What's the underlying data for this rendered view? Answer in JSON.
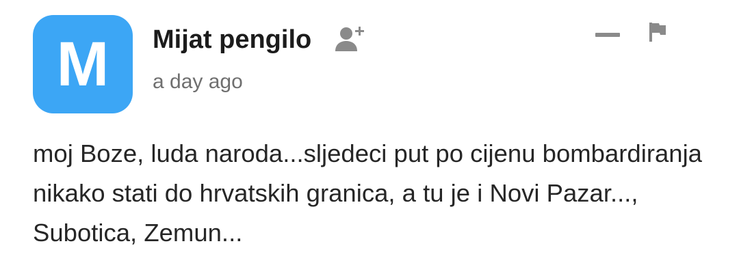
{
  "comment": {
    "avatar": {
      "letter": "M",
      "color": "#3ca6f5"
    },
    "author": "Mijat pengilo",
    "timestamp": "a day ago",
    "text": "moj Boze, luda naroda...sljedeci put po cijenu bombardiranja nikako stati do hrvatskih granica, a tu je i Novi Pazar..., Subotica, Zemun...",
    "icons": {
      "follow": "add-user-icon",
      "collapse": "collapse-icon",
      "report": "flag-icon"
    },
    "colors": {
      "icon_gray": "#8a8a8a",
      "timestamp_gray": "#6f6f6f"
    }
  }
}
